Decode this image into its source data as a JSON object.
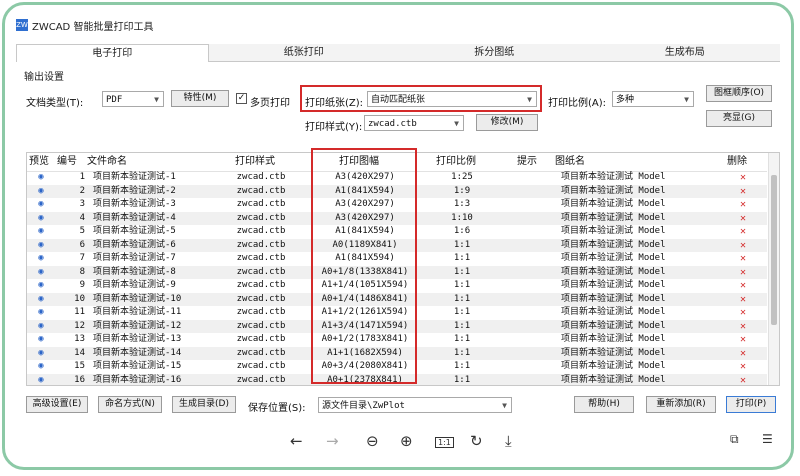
{
  "window": {
    "title": "ZWCAD 智能批量打印工具",
    "icon_text": "ZW"
  },
  "tabs": [
    {
      "label": "电子打印",
      "active": true
    },
    {
      "label": "纸张打印",
      "active": false
    },
    {
      "label": "拆分图纸",
      "active": false
    },
    {
      "label": "生成布局",
      "active": false
    }
  ],
  "output_settings": {
    "group_label": "输出设置",
    "doc_type_label": "文档类型(T):",
    "doc_type_value": "PDF",
    "properties_button": "特性(M)",
    "multipage_label": "多页打印",
    "multipage_checked": true,
    "paper_label": "打印纸张(Z):",
    "paper_value": "自动匹配纸张",
    "scale_label": "打印比例(A):",
    "scale_value": "多种",
    "frame_order_button": "图框顺序(O)",
    "style_label": "打印样式(Y):",
    "style_value": "zwcad.ctb",
    "modify_button": "修改(M)",
    "highlight_button": "亮显(G)"
  },
  "table": {
    "columns": [
      "预览",
      "编号",
      "文件命名",
      "打印样式",
      "打印图幅",
      "打印比例",
      "提示",
      "图纸名",
      "删除"
    ],
    "rows": [
      {
        "num": "1",
        "name": "项目新本验证测试-1",
        "style": "zwcad.ctb",
        "paper": "A3(420X297)",
        "scale": "1:25",
        "tip": "",
        "sheet": "项目新本验证测试 Model"
      },
      {
        "num": "2",
        "name": "项目新本验证测试-2",
        "style": "zwcad.ctb",
        "paper": "A1(841X594)",
        "scale": "1:9",
        "tip": "",
        "sheet": "项目新本验证测试 Model"
      },
      {
        "num": "3",
        "name": "项目新本验证测试-3",
        "style": "zwcad.ctb",
        "paper": "A3(420X297)",
        "scale": "1:3",
        "tip": "",
        "sheet": "项目新本验证测试 Model"
      },
      {
        "num": "4",
        "name": "项目新本验证测试-4",
        "style": "zwcad.ctb",
        "paper": "A3(420X297)",
        "scale": "1:10",
        "tip": "",
        "sheet": "项目新本验证测试 Model"
      },
      {
        "num": "5",
        "name": "项目新本验证测试-5",
        "style": "zwcad.ctb",
        "paper": "A1(841X594)",
        "scale": "1:6",
        "tip": "",
        "sheet": "项目新本验证测试 Model"
      },
      {
        "num": "6",
        "name": "项目新本验证测试-6",
        "style": "zwcad.ctb",
        "paper": "A0(1189X841)",
        "scale": "1:1",
        "tip": "",
        "sheet": "项目新本验证测试 Model"
      },
      {
        "num": "7",
        "name": "项目新本验证测试-7",
        "style": "zwcad.ctb",
        "paper": "A1(841X594)",
        "scale": "1:1",
        "tip": "",
        "sheet": "项目新本验证测试 Model"
      },
      {
        "num": "8",
        "name": "项目新本验证测试-8",
        "style": "zwcad.ctb",
        "paper": "A0+1/8(1338X841)",
        "scale": "1:1",
        "tip": "",
        "sheet": "项目新本验证测试 Model"
      },
      {
        "num": "9",
        "name": "项目新本验证测试-9",
        "style": "zwcad.ctb",
        "paper": "A1+1/4(1051X594)",
        "scale": "1:1",
        "tip": "",
        "sheet": "项目新本验证测试 Model"
      },
      {
        "num": "10",
        "name": "项目新本验证测试-10",
        "style": "zwcad.ctb",
        "paper": "A0+1/4(1486X841)",
        "scale": "1:1",
        "tip": "",
        "sheet": "项目新本验证测试 Model"
      },
      {
        "num": "11",
        "name": "项目新本验证测试-11",
        "style": "zwcad.ctb",
        "paper": "A1+1/2(1261X594)",
        "scale": "1:1",
        "tip": "",
        "sheet": "项目新本验证测试 Model"
      },
      {
        "num": "12",
        "name": "项目新本验证测试-12",
        "style": "zwcad.ctb",
        "paper": "A1+3/4(1471X594)",
        "scale": "1:1",
        "tip": "",
        "sheet": "项目新本验证测试 Model"
      },
      {
        "num": "13",
        "name": "项目新本验证测试-13",
        "style": "zwcad.ctb",
        "paper": "A0+1/2(1783X841)",
        "scale": "1:1",
        "tip": "",
        "sheet": "项目新本验证测试 Model"
      },
      {
        "num": "14",
        "name": "项目新本验证测试-14",
        "style": "zwcad.ctb",
        "paper": "A1+1(1682X594)",
        "scale": "1:1",
        "tip": "",
        "sheet": "项目新本验证测试 Model"
      },
      {
        "num": "15",
        "name": "项目新本验证测试-15",
        "style": "zwcad.ctb",
        "paper": "A0+3/4(2080X841)",
        "scale": "1:1",
        "tip": "",
        "sheet": "项目新本验证测试 Model"
      },
      {
        "num": "16",
        "name": "项目新本验证测试-16",
        "style": "zwcad.ctb",
        "paper": "A0+1(2378X841)",
        "scale": "1:1",
        "tip": "",
        "sheet": "项目新本验证测试 Model"
      }
    ]
  },
  "bottom_bar": {
    "advanced_button": "高级设置(E)",
    "naming_button": "命名方式(N)",
    "gen_dir_button": "生成目录(D)",
    "save_label": "保存位置(S):",
    "save_value": "源文件目录\\ZwPlot",
    "help_button": "帮助(H)",
    "readd_button": "重新添加(R)",
    "print_button": "打印(P)"
  },
  "viewer_toolbar": {
    "back_icon": "←",
    "forward_icon": "→",
    "zoom_out_icon": "⊖",
    "zoom_in_icon": "⊕",
    "fit_icon": "1:1",
    "rotate_icon": "↻",
    "download_icon": "⤓"
  },
  "colors": {
    "highlight_red": "#d42a2a",
    "frame_green": "#8cc9a6",
    "eye_blue": "#2a64c8"
  }
}
